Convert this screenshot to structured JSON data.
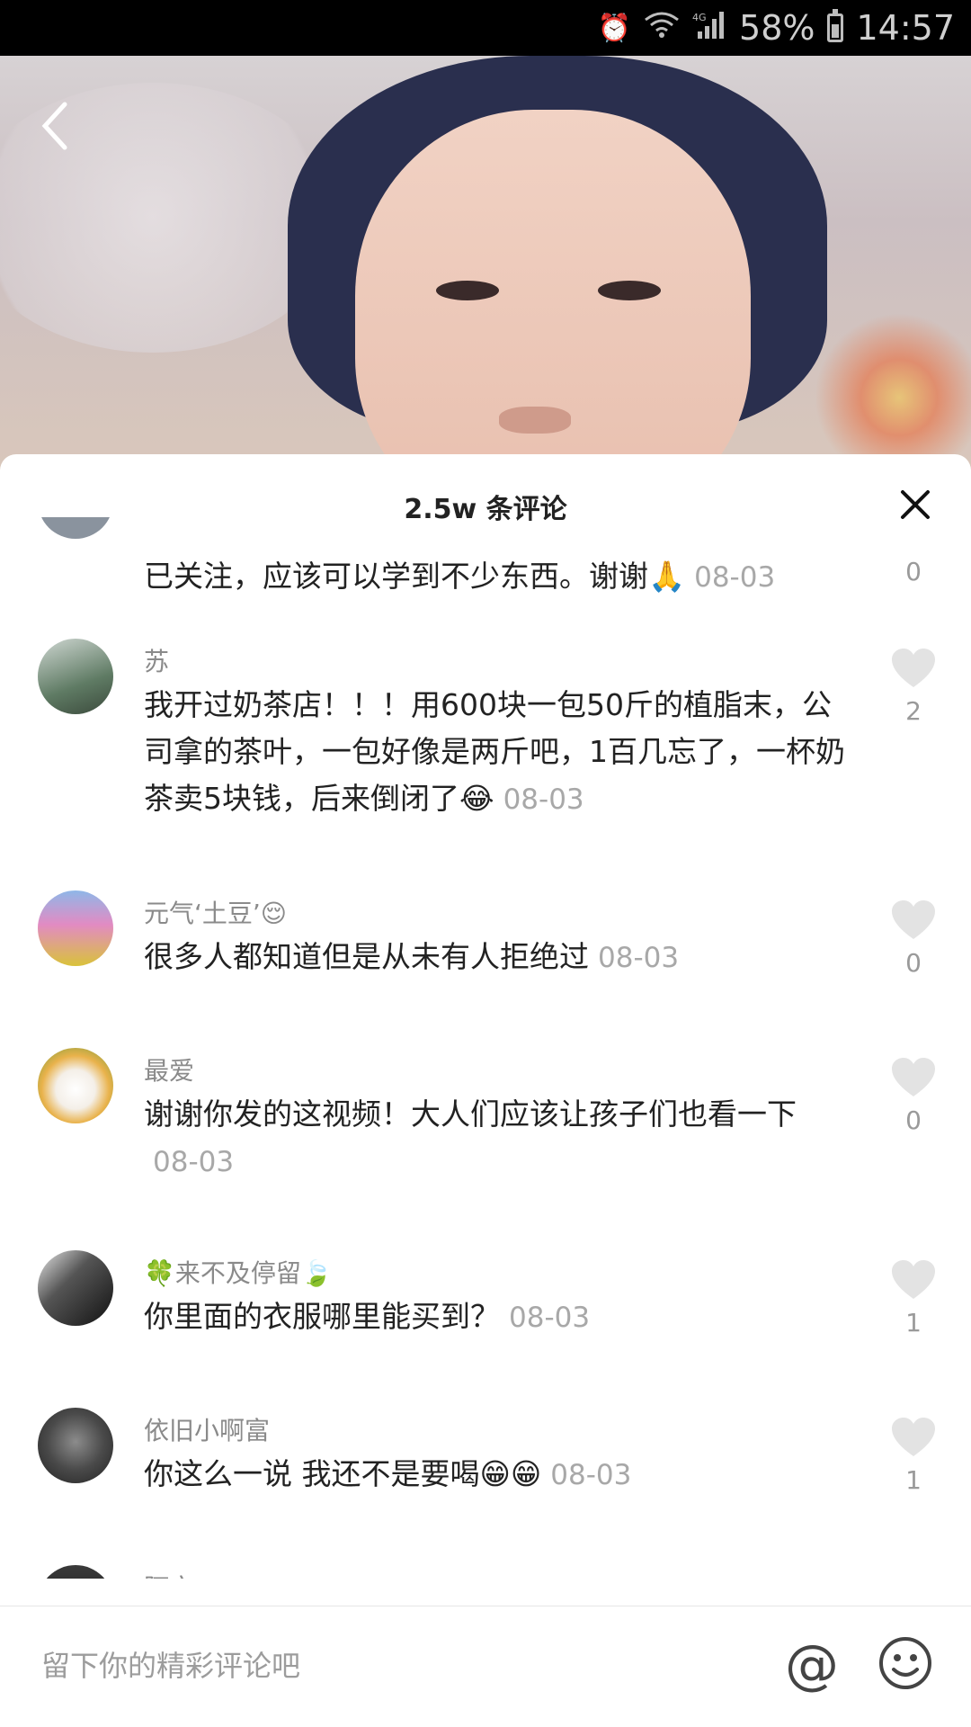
{
  "status_bar": {
    "battery": "58%",
    "time": "14:57",
    "signal": "4G"
  },
  "panel": {
    "title": "2.5w 条评论"
  },
  "comments": [
    {
      "username": "",
      "text": "已关注，应该可以学到不少东西。谢谢🙏",
      "date": "08-03",
      "likes": "0"
    },
    {
      "username": "苏",
      "text": "我开过奶茶店！！！用600块一包50斤的植脂末，公司拿的茶叶，一包好像是两斤吧，1百几忘了，一杯奶茶卖5块钱，后来倒闭了😂",
      "date": "08-03",
      "likes": "2"
    },
    {
      "username": "元气‘土豆’😌",
      "text": "很多人都知道但是从未有人拒绝过",
      "date": "08-03",
      "likes": "0"
    },
    {
      "username": "最爱",
      "text": "谢谢你发的这视频！大人们应该让孩子们也看一下",
      "date": "08-03",
      "likes": "0"
    },
    {
      "username": "🍀来不及停留🍃",
      "text": "你里面的衣服哪里能买到？",
      "date": "08-03",
      "likes": "1"
    },
    {
      "username": "依旧小啊富",
      "text": "你这么一说 我还不是要喝😁😁",
      "date": "08-03",
      "likes": "1"
    },
    {
      "username": "阿文",
      "text": "",
      "date": "",
      "likes": ""
    }
  ],
  "input": {
    "placeholder": "留下你的精彩评论吧",
    "value": "",
    "at_symbol": "@"
  },
  "icons": {
    "back": "back-arrow-icon",
    "close": "close-icon",
    "like": "heart-icon",
    "emoji": "smiley-icon"
  },
  "colors": {
    "like_heart": "#e3e3e3",
    "muted_text": "#8a8a8a"
  }
}
